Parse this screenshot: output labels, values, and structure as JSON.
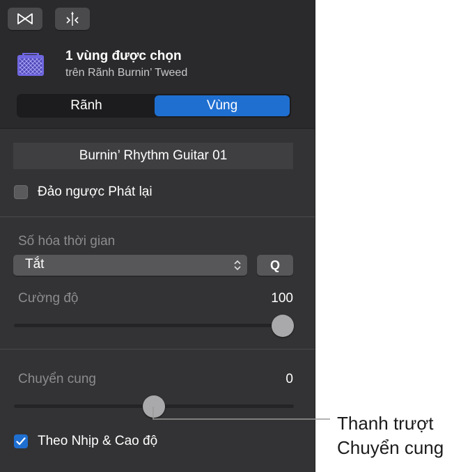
{
  "header": {
    "toolbar": {
      "buttons": [
        {
          "icon": "bowtie-icon"
        },
        {
          "icon": "split-at-playhead-icon"
        }
      ]
    },
    "region_icon": "amp-icon",
    "title": "1 vùng được chọn",
    "subtitle": "trên Rãnh Burnin’ Tweed",
    "tabs": [
      {
        "label": "Rãnh",
        "selected": false
      },
      {
        "label": "Vùng",
        "selected": true
      }
    ]
  },
  "region": {
    "name": "Burnin’ Rhythm Guitar 01",
    "reverse_playback": {
      "label": "Đảo ngược Phát lại",
      "checked": false
    }
  },
  "quantize": {
    "label": "Số hóa thời gian",
    "popup_value": "Tắt",
    "q_button": "Q",
    "strength_label": "Cường độ",
    "strength_value": "100",
    "strength_fraction": 1.0
  },
  "transpose": {
    "label": "Chuyển cung",
    "value": "0",
    "slider_fraction": 0.5,
    "follow_tempo": {
      "label": "Theo Nhịp & Cao độ",
      "checked": true
    }
  },
  "callout": {
    "line1": "Thanh trượt",
    "line2": "Chuyển cung"
  },
  "colors": {
    "accent": "#1f6fd1",
    "panel_bg": "#333335",
    "header_bg": "#2a2a2c",
    "region_icon": "#6f67e0"
  }
}
